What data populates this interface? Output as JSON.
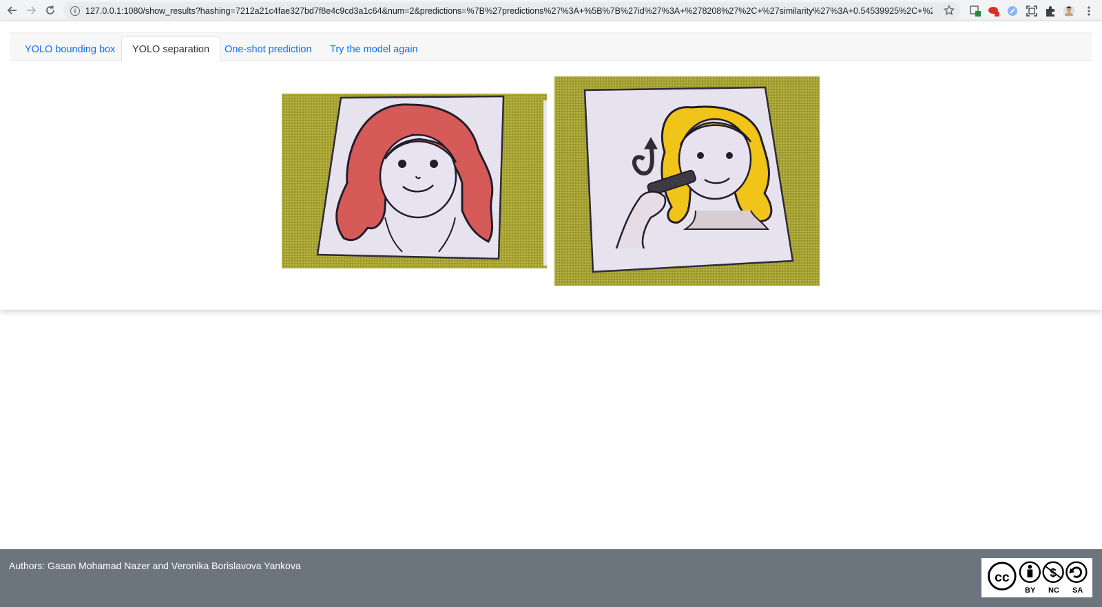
{
  "browser": {
    "url": "127.0.0.1:1080/show_results?hashing=7212a21c4fae327bd7f8e4c9cd3a1c64&num=2&predictions=%7B%27predictions%27%3A+%5B%7B%27id%27%3A+%278208%27%2C+%27similarity%27%3A+0.54539925%2C+%27p..."
  },
  "tabs": [
    {
      "label": "YOLO bounding box",
      "active": false
    },
    {
      "label": "YOLO separation",
      "active": true
    },
    {
      "label": "One-shot prediction",
      "active": false
    },
    {
      "label": "Try the model again",
      "active": false
    }
  ],
  "footer": {
    "authors": "Authors: Gasan Mohamad Nazer and Veronika Borislavova Yankova",
    "license_labels": [
      "BY",
      "NC",
      "SA"
    ]
  },
  "colors": {
    "link": "#0d6efd",
    "footer_bg": "#6c757d",
    "fabric": "#a8a332",
    "red_hair": "#d65a57",
    "yellow_hair": "#f0c417"
  }
}
